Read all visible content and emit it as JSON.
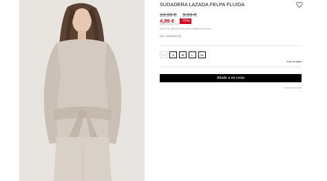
{
  "product": {
    "title": "SUDADERA LAZADA FELPA FLUIDA",
    "old_prices": [
      "19,99 €",
      "9,99 €"
    ],
    "new_price": "4,99 €",
    "discount": "-75%",
    "period_note": "Sale 01/01 al 01/04",
    "tax_note": "Descuento aplicado sobre precio original del artículo",
    "reference": "Ref: 1200/304/723"
  },
  "sizes": {
    "options": [
      {
        "label": "XS",
        "available": false
      },
      {
        "label": "S",
        "available": true
      },
      {
        "label": "M",
        "available": true
      },
      {
        "label": "L",
        "available": true
      },
      {
        "label": "XL",
        "available": true
      }
    ],
    "guide_label": "Guía de tallas"
  },
  "actions": {
    "add_to_cart": "Añadir a mi cesta",
    "secondary_link": "Vendido por la tienda"
  },
  "icons": {
    "favorite": "heart-outline-icon"
  },
  "colors": {
    "sale_red": "#d0021b",
    "button_black": "#000000",
    "garment": "#cfc4bb"
  }
}
